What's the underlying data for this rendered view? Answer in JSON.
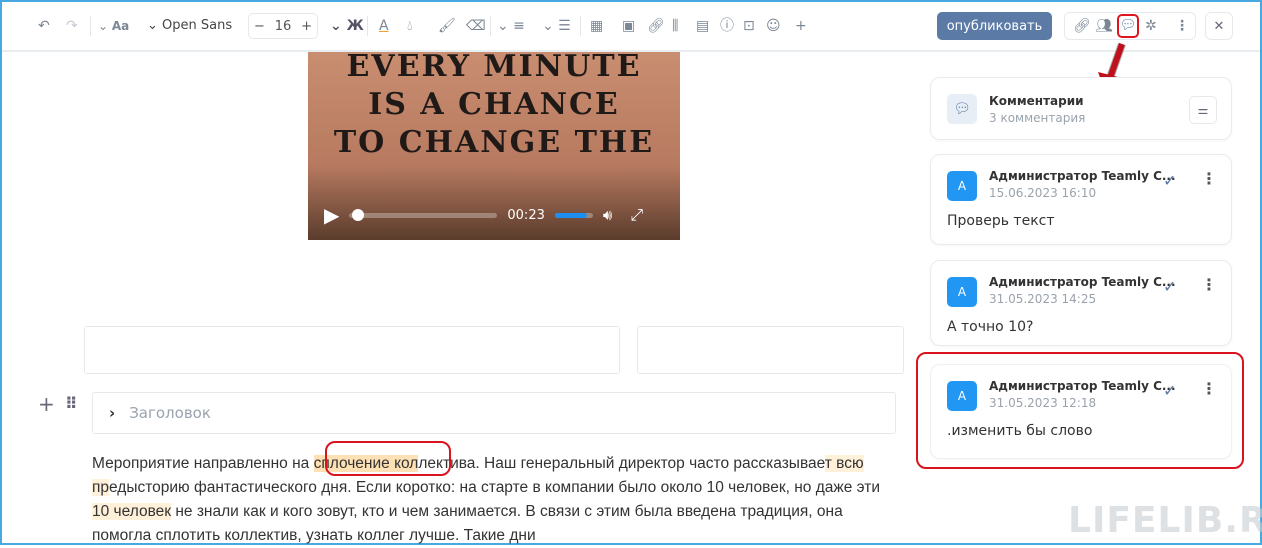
{
  "toolbar": {
    "font_family": "Open Sans",
    "font_size": "16",
    "bold_label": "Ж",
    "text_size_icon": "Aa",
    "publish": "опубликовать"
  },
  "video": {
    "caption_lines": [
      "EVERY MINUTE",
      "IS A CHANCE",
      "TO CHANGE THE"
    ],
    "time": "00:23",
    "progress": 0.02,
    "volume": 0.85
  },
  "editor": {
    "heading_placeholder": "Заголовок",
    "paragraph": [
      {
        "t": "Мероприятие направленно на "
      },
      {
        "t": "сплочение кол",
        "h": 1
      },
      {
        "t": "лектива. Наш генеральный директор часто рассказывае"
      },
      {
        "t": "т всю пр",
        "h": 2
      },
      {
        "t": "едысторию фантастического дня. Если коротко: на старте в компании было около 10 человек, но даже эти "
      },
      {
        "t": "10 человек",
        "h": 2
      },
      {
        "t": " не знали как и кого зовут, кто и чем занимается. В связи с этим была введена традиция, она помогла сплотить коллектив, узнать коллег лучше. Такие дни"
      }
    ]
  },
  "comments": {
    "title": "Комментарии",
    "count": "3 комментария",
    "items": [
      {
        "avatar": "А",
        "author": "Администратор Teamly C...",
        "date": "15.06.2023 16:10",
        "text": "Проверь текст"
      },
      {
        "avatar": "А",
        "author": "Администратор Teamly C...",
        "date": "31.05.2023 14:25",
        "text": "А точно 10?"
      },
      {
        "avatar": "А",
        "author": "Администратор Teamly C...",
        "date": "31.05.2023 12:18",
        "text": ".изменить бы слово"
      }
    ]
  },
  "watermark": "LIFELIB.RU"
}
